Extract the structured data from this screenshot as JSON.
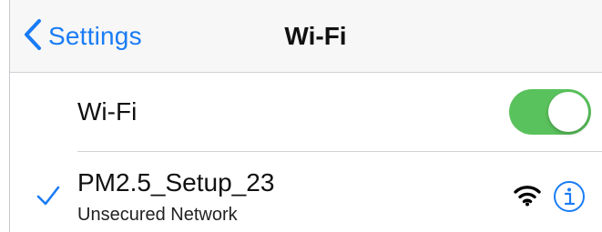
{
  "navbar": {
    "back_label": "Settings",
    "title": "Wi-Fi",
    "back_icon": "chevron-left-icon"
  },
  "wifi_row": {
    "label": "Wi-Fi",
    "toggle_on": true
  },
  "networks": [
    {
      "name": "PM2.5_Setup_23",
      "subtitle": "Unsecured Network",
      "connected": true,
      "icons": [
        "checkmark-icon",
        "wifi-signal-icon",
        "info-icon"
      ]
    }
  ],
  "colors": {
    "accent": "#1a7cf5",
    "toggle_on": "#5ac25c",
    "navbar_bg": "#f7f7f7",
    "separator": "#d1d1d6"
  }
}
